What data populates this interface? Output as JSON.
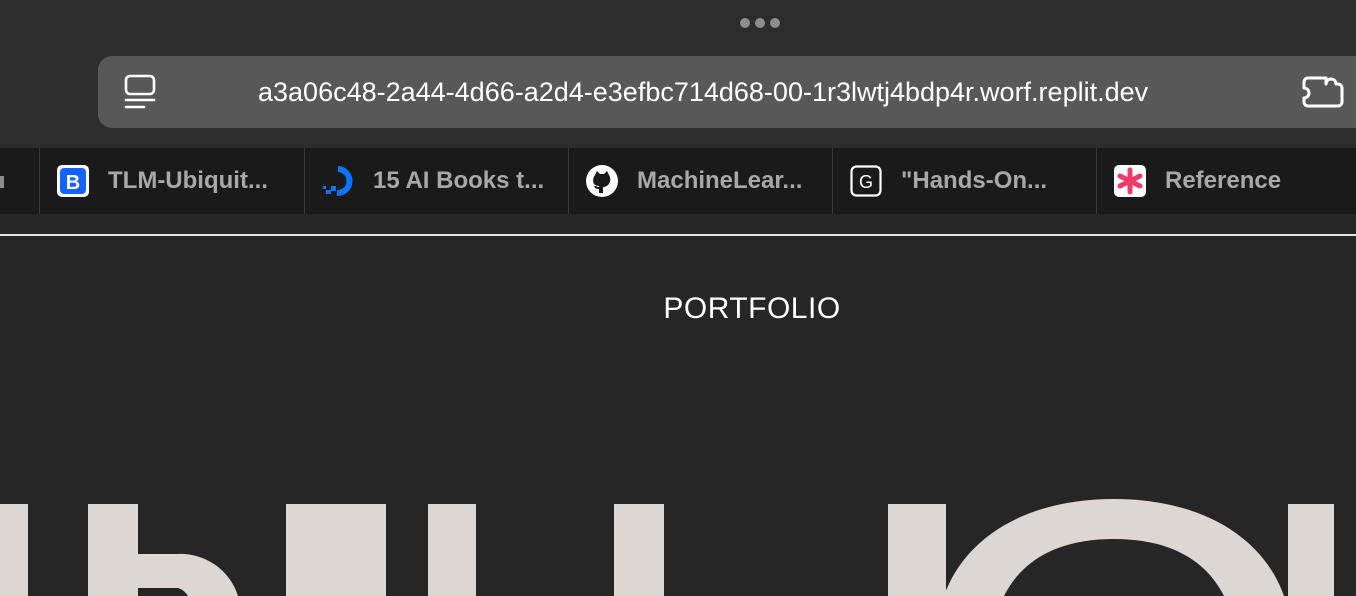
{
  "window": {
    "more_icon": "three-dots-icon"
  },
  "address_bar": {
    "url": "a3a06c48-2a44-4d66-a2d4-e3efbc714d68-00-1r3lwtj4bdp4r.worf.replit.dev",
    "left_icon": "reader-mode-icon",
    "right_icon": "extension-icon"
  },
  "tabs": [
    {
      "label": "TLM-Ubiquit...",
      "icon": "b-logo-icon",
      "color": "#1463ff"
    },
    {
      "label": "15 AI Books t...",
      "icon": "digitalocean-icon",
      "color": "#0a74ff"
    },
    {
      "label": "MachineLear...",
      "icon": "github-icon",
      "color": "#ffffff"
    },
    {
      "label": "\"Hands-On...",
      "icon": "g-square-icon",
      "color": "#ffffff"
    },
    {
      "label": "Reference",
      "icon": "asterisk-icon",
      "color": "#f23a6a"
    }
  ],
  "page": {
    "nav_title": "PORTFOLIO",
    "hero_color": "#dcd7d3"
  },
  "colors": {
    "background": "#262626",
    "address_bar": "#585858",
    "tab_strip": "#1a1a1a"
  }
}
